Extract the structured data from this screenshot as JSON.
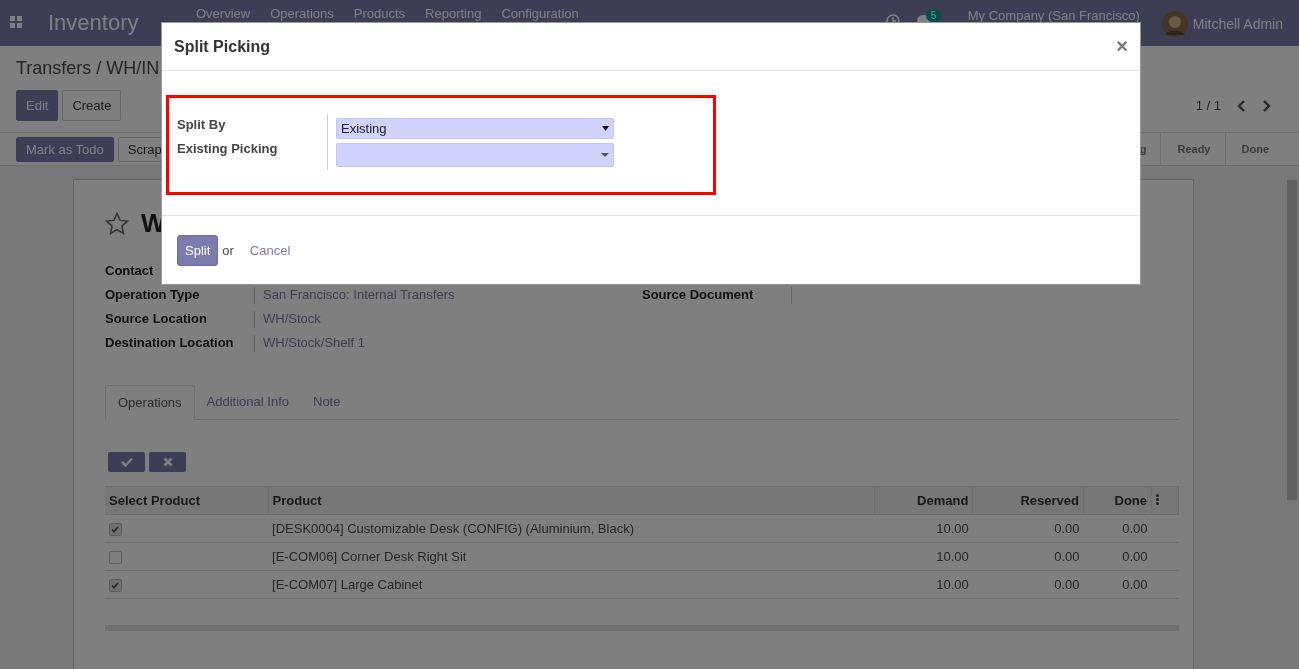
{
  "navbar": {
    "app_name": "Inventory",
    "menu": [
      "Overview",
      "Operations",
      "Products",
      "Reporting",
      "Configuration"
    ],
    "chat_badge": "5",
    "company": "My Company (San Francisco)",
    "user": "Mitchell Admin"
  },
  "control_panel": {
    "breadcrumb": "Transfers / WH/IN",
    "buttons": [
      {
        "label": "Edit",
        "primary": true
      },
      {
        "label": "Create",
        "primary": false
      }
    ],
    "pager": "1 / 1"
  },
  "status_bar": {
    "buttons": [
      {
        "label": "Mark as Todo",
        "primary": true
      },
      {
        "label": "Scrap",
        "primary": false
      }
    ],
    "stages": [
      "g",
      "Ready",
      "Done"
    ]
  },
  "sheet": {
    "starred": false,
    "title": "W",
    "fields_left": [
      {
        "label": "Contact"
      },
      {
        "label": "Operation Type",
        "value": "San Francisco: Internal Transfers"
      },
      {
        "label": "Source Location",
        "value": "WH/Stock"
      },
      {
        "label": "Destination Location",
        "value": "WH/Stock/Shelf 1"
      }
    ],
    "fields_right": [
      {
        "label": "Source Document"
      }
    ],
    "tabs": [
      {
        "label": "Operations",
        "selected": true
      },
      {
        "label": "Additional Info",
        "selected": false
      },
      {
        "label": "Note",
        "selected": false
      }
    ],
    "table": {
      "columns": [
        "Select Product",
        "Product",
        "Demand",
        "Reserved",
        "Done"
      ],
      "rows": [
        {
          "checked": true,
          "product": "[DESK0004] Customizable Desk (CONFIG) (Aluminium, Black)",
          "demand": "10.00",
          "reserved": "0.00",
          "done": "0.00"
        },
        {
          "checked": false,
          "product": "[E-COM06] Corner Desk Right Sit",
          "demand": "10.00",
          "reserved": "0.00",
          "done": "0.00"
        },
        {
          "checked": true,
          "product": "[E-COM07] Large Cabinet",
          "demand": "10.00",
          "reserved": "0.00",
          "done": "0.00"
        }
      ]
    }
  },
  "dialog": {
    "title": "Split Picking",
    "close": "×",
    "fields": [
      {
        "label": "Split By",
        "kind": "select",
        "value": "Existing"
      },
      {
        "label": "Existing Picking",
        "kind": "many2one"
      }
    ],
    "footer": {
      "primary": "Split",
      "separator": "or",
      "cancel": "Cancel"
    }
  }
}
